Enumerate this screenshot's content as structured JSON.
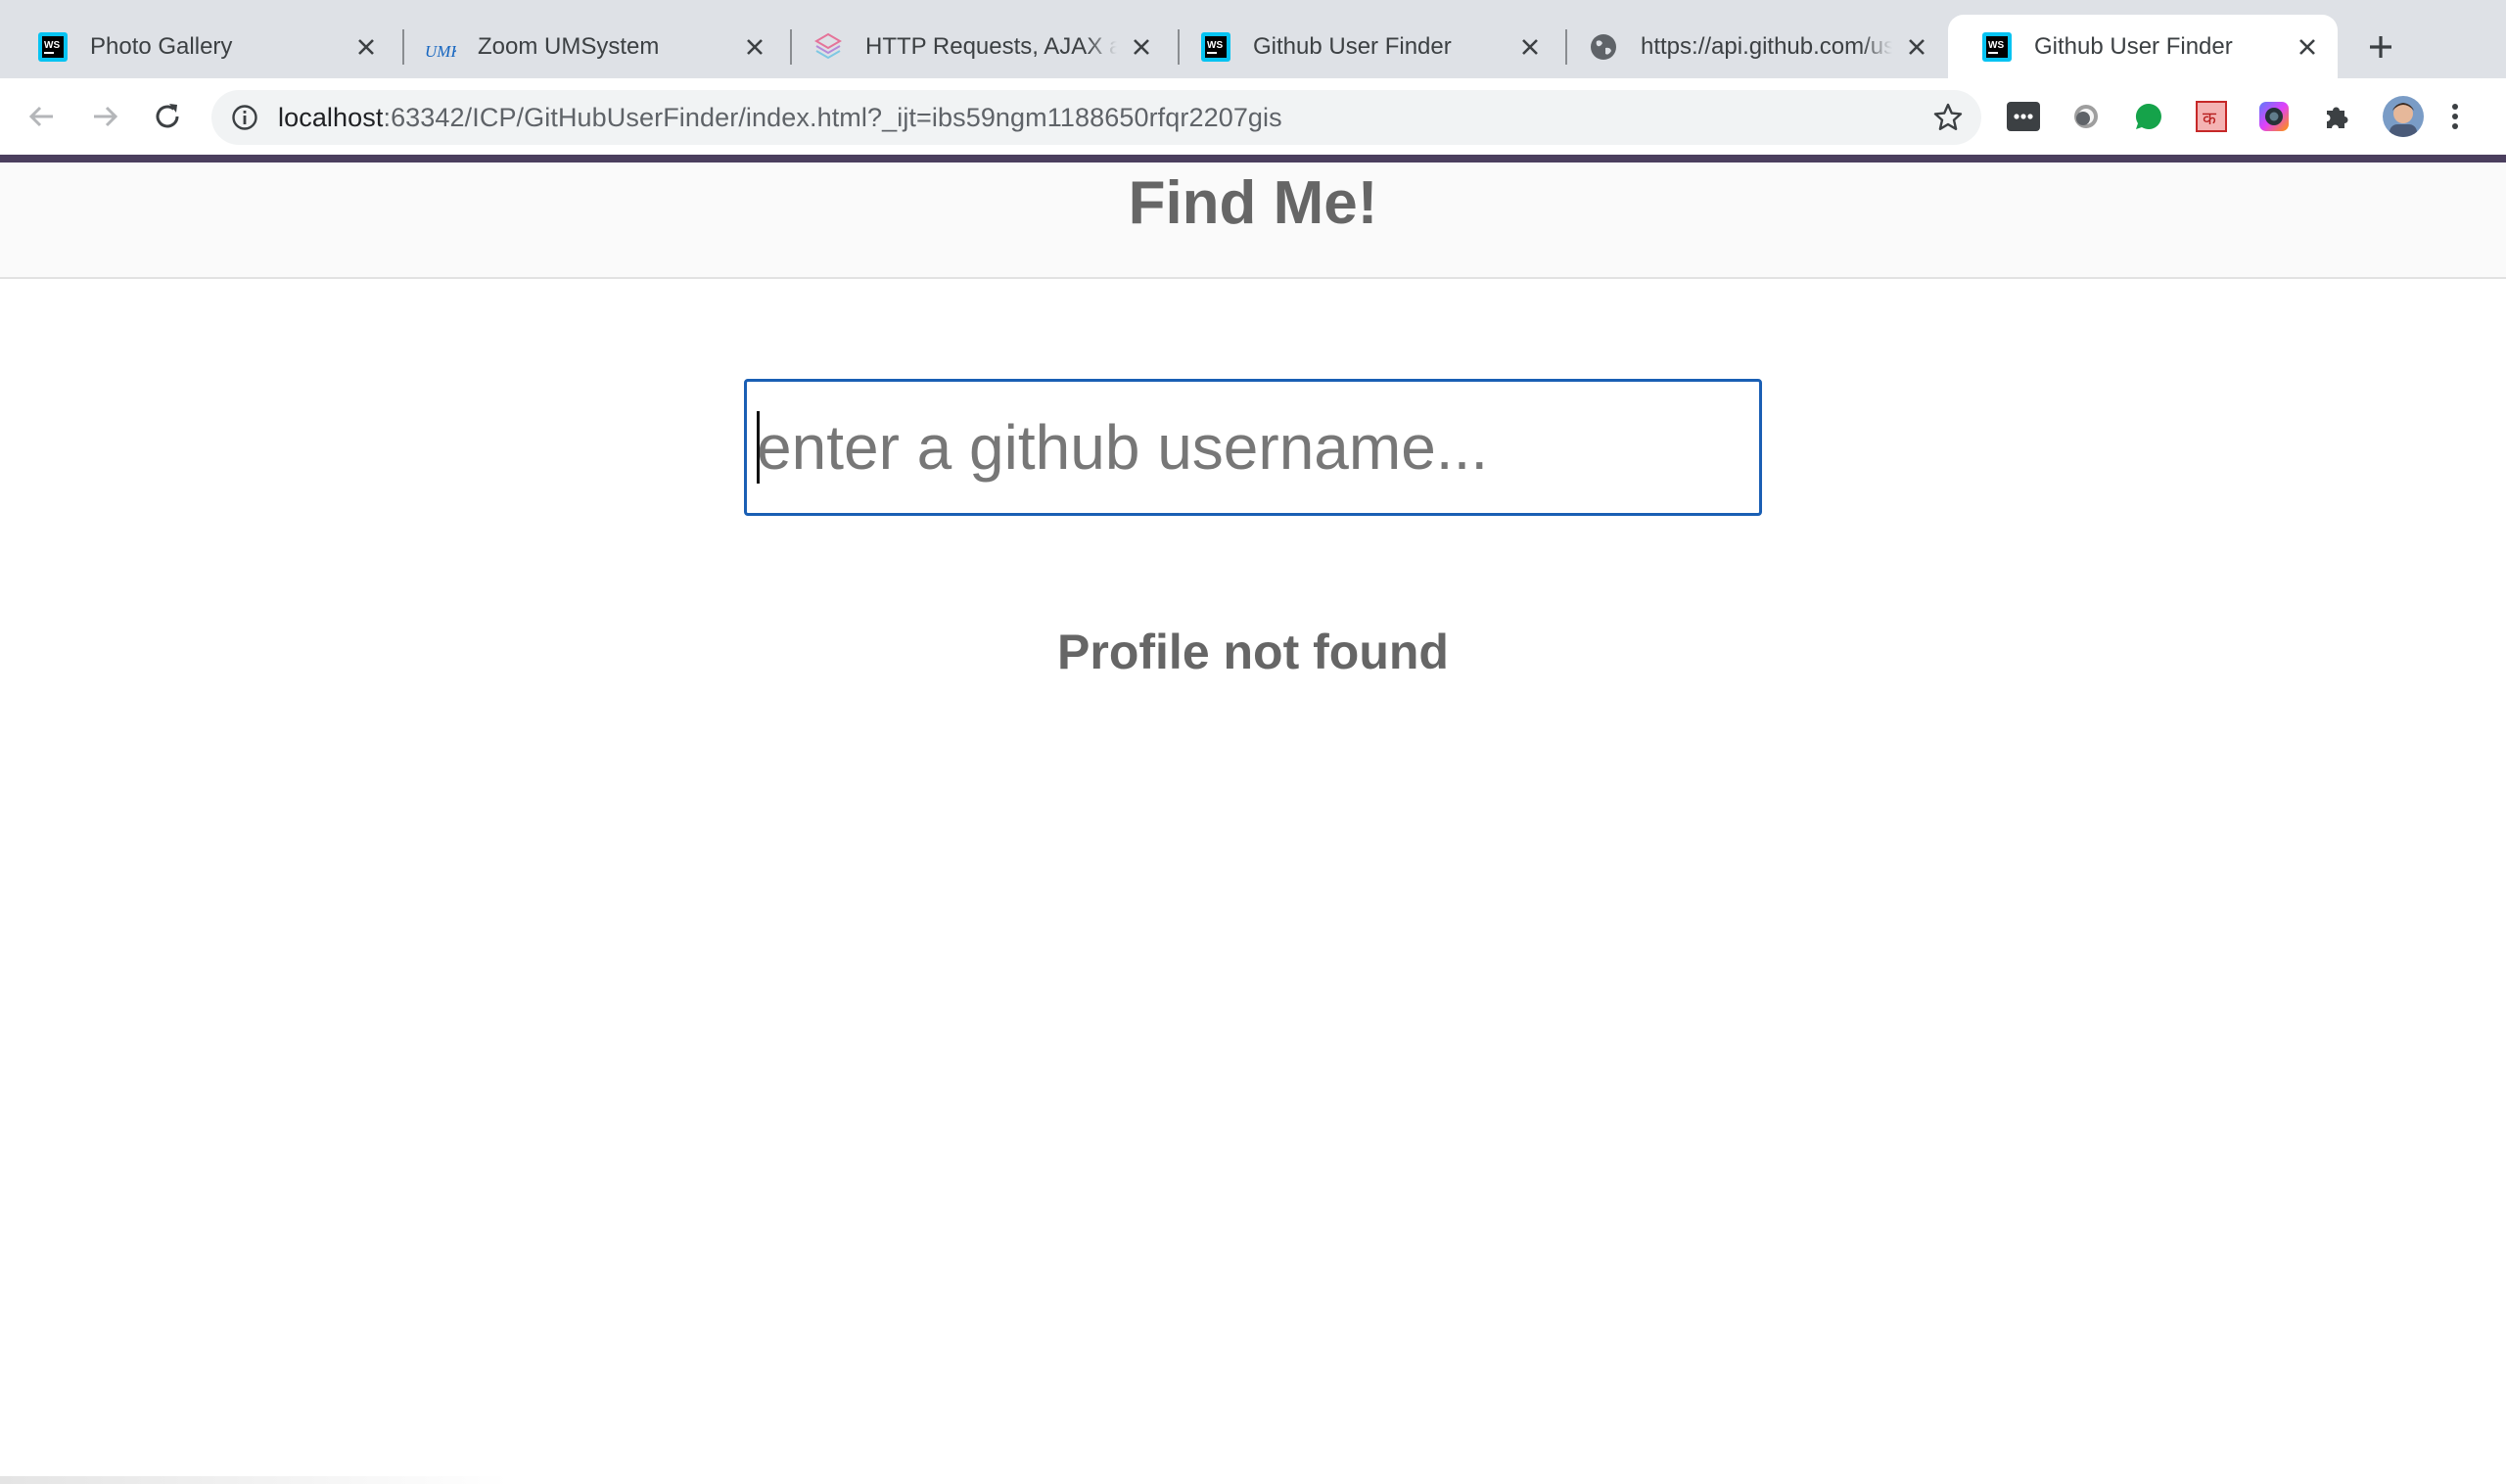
{
  "browser": {
    "tabs": [
      {
        "title": "Photo Gallery",
        "icon": "webstorm-icon",
        "active": false
      },
      {
        "title": "Zoom UMSystem",
        "icon": "umkc-icon",
        "active": false
      },
      {
        "title": "HTTP Requests, AJAX and APIs",
        "icon": "stack-icon",
        "active": false
      },
      {
        "title": "Github User Finder",
        "icon": "webstorm-icon",
        "active": false
      },
      {
        "title": "https://api.github.com/users",
        "icon": "globe-icon",
        "active": false
      },
      {
        "title": "Github User Finder",
        "icon": "webstorm-icon",
        "active": true
      }
    ],
    "address": {
      "host": "localhost",
      "path": ":63342/ICP/GitHubUserFinder/index.html?_ijt=ibs59ngm1188650rfqr2207gis"
    },
    "extensions": [
      "dots-extension-icon",
      "circle-extension-icon",
      "green-dot-extension-icon",
      "ka-extension-icon",
      "camera-extension-icon",
      "puzzle-icon"
    ]
  },
  "page": {
    "title": "Find Me!",
    "search": {
      "placeholder": "enter a github username...",
      "value": ""
    },
    "status": "Profile not found"
  },
  "colors": {
    "accent_bar": "#4b3f5e",
    "input_border": "#1a5fb4",
    "text": "#666666"
  }
}
